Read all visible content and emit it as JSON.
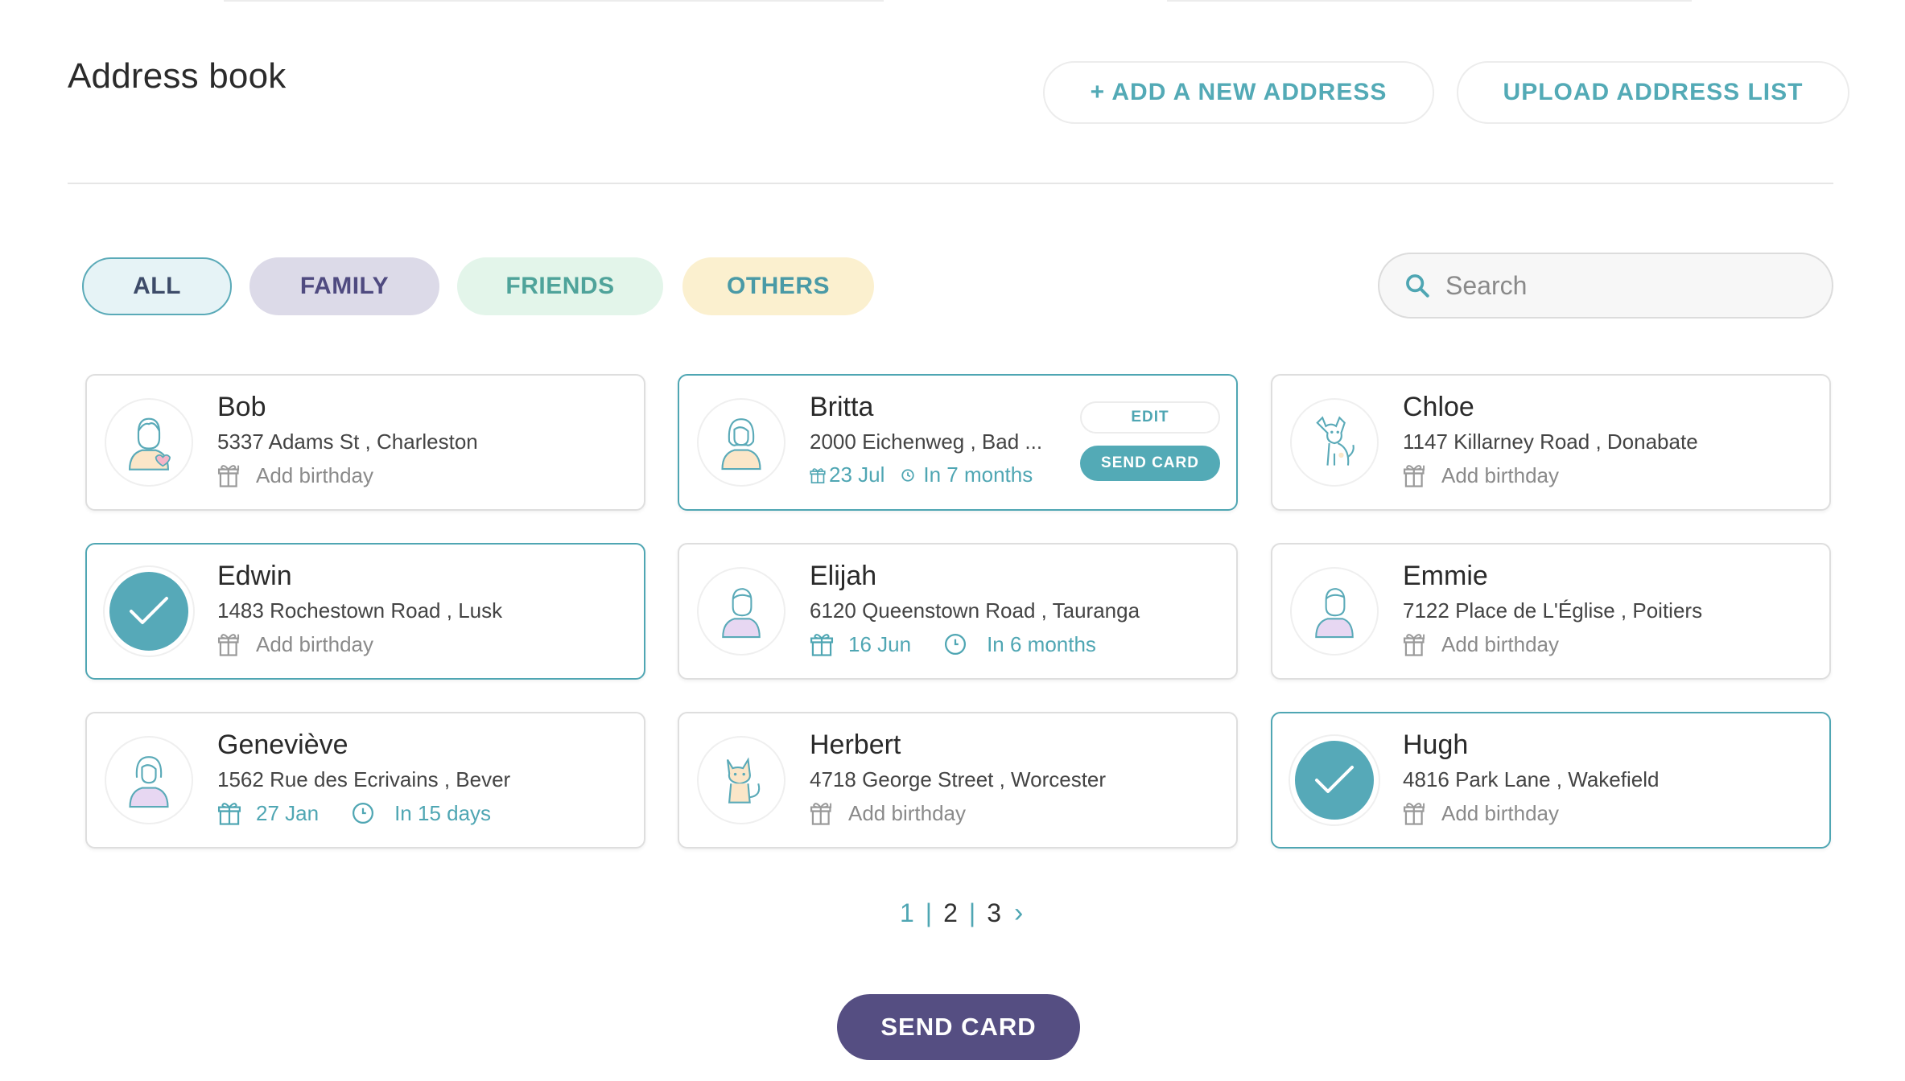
{
  "header": {
    "title": "Address book",
    "add_address_label": "+ ADD A NEW ADDRESS",
    "upload_list_label": "UPLOAD ADDRESS LIST"
  },
  "filters": {
    "all": "ALL",
    "family": "FAMILY",
    "friends": "FRIENDS",
    "others": "OTHERS"
  },
  "search": {
    "placeholder": "Search"
  },
  "contacts": [
    {
      "name": "Bob",
      "address": "5337 Adams St , Charleston",
      "birthday": "Add birthday"
    },
    {
      "name": "Britta",
      "address": "2000 Eichenweg , Bad ...",
      "birthday_date": "23 Jul",
      "birthday_in": "In 7 months",
      "edit_label": "EDIT",
      "send_label": "SEND CARD"
    },
    {
      "name": "Chloe",
      "address": "1147 Killarney Road , Donabate",
      "birthday": "Add birthday"
    },
    {
      "name": "Edwin",
      "address": "1483 Rochestown Road , Lusk",
      "birthday": "Add birthday"
    },
    {
      "name": "Elijah",
      "address": "6120 Queenstown Road , Tauranga",
      "birthday_date": "16 Jun",
      "birthday_in": "In 6 months"
    },
    {
      "name": "Emmie",
      "address": "7122 Place de L'Église , Poitiers",
      "birthday": "Add birthday"
    },
    {
      "name": "Geneviève",
      "address": "1562 Rue des Ecrivains , Bever",
      "birthday_date": "27 Jan",
      "birthday_in": "In 15 days"
    },
    {
      "name": "Herbert",
      "address": "4718 George Street , Worcester",
      "birthday": "Add birthday"
    },
    {
      "name": "Hugh",
      "address": "4816 Park Lane , Wakefield",
      "birthday": "Add birthday"
    }
  ],
  "pagination": {
    "pages": [
      "1",
      "2",
      "3"
    ],
    "current": "1",
    "separator": "|",
    "next": "›"
  },
  "footer": {
    "send_label": "SEND CARD"
  },
  "colors": {
    "teal": "#53aab6",
    "purple": "#554e82",
    "family_bg": "#dcdae8",
    "friends_bg": "#e3f5ea",
    "others_bg": "#fbf0cf"
  }
}
